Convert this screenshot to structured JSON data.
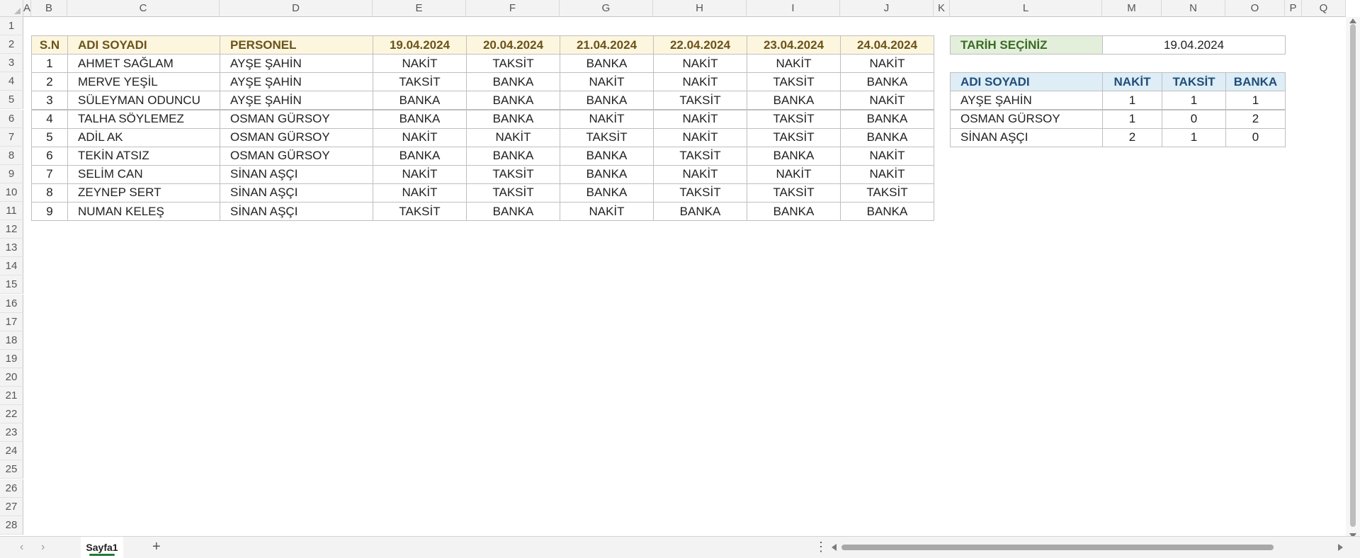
{
  "sheet": {
    "columns": [
      "A",
      "B",
      "C",
      "D",
      "E",
      "F",
      "G",
      "H",
      "I",
      "J",
      "K",
      "L",
      "M",
      "N",
      "O",
      "P",
      "Q"
    ],
    "rows": [
      "1",
      "2",
      "3",
      "4",
      "5",
      "6",
      "7",
      "8",
      "9",
      "10",
      "11",
      "12",
      "13",
      "14",
      "15",
      "16",
      "17",
      "18",
      "19",
      "20",
      "21",
      "22",
      "23",
      "24",
      "25",
      "26",
      "27",
      "28"
    ]
  },
  "main_table": {
    "headers": [
      "S.N",
      "ADI SOYADI",
      "PERSONEL",
      "19.04.2024",
      "20.04.2024",
      "21.04.2024",
      "22.04.2024",
      "23.04.2024",
      "24.04.2024"
    ],
    "rows": [
      [
        "1",
        "AHMET SAĞLAM",
        "AYŞE ŞAHİN",
        "NAKİT",
        "TAKSİT",
        "BANKA",
        "NAKİT",
        "NAKİT",
        "NAKİT"
      ],
      [
        "2",
        "MERVE YEŞİL",
        "AYŞE ŞAHİN",
        "TAKSİT",
        "BANKA",
        "NAKİT",
        "NAKİT",
        "TAKSİT",
        "BANKA"
      ],
      [
        "3",
        "SÜLEYMAN ODUNCU",
        "AYŞE ŞAHİN",
        "BANKA",
        "BANKA",
        "BANKA",
        "TAKSİT",
        "BANKA",
        "NAKİT"
      ],
      [
        "4",
        "TALHA SÖYLEMEZ",
        "OSMAN GÜRSOY",
        "BANKA",
        "BANKA",
        "NAKİT",
        "NAKİT",
        "TAKSİT",
        "BANKA"
      ],
      [
        "5",
        "ADİL AK",
        "OSMAN GÜRSOY",
        "NAKİT",
        "NAKİT",
        "TAKSİT",
        "NAKİT",
        "TAKSİT",
        "BANKA"
      ],
      [
        "6",
        " TEKİN ATSIZ",
        "OSMAN GÜRSOY",
        "BANKA",
        "BANKA",
        "BANKA",
        "TAKSİT",
        "BANKA",
        "NAKİT"
      ],
      [
        "7",
        "SELİM CAN",
        "SİNAN AŞÇI",
        "NAKİT",
        "TAKSİT",
        "BANKA",
        "NAKİT",
        "NAKİT",
        "NAKİT"
      ],
      [
        "8",
        "ZEYNEP SERT",
        "SİNAN AŞÇI",
        "NAKİT",
        "TAKSİT",
        "BANKA",
        "TAKSİT",
        "TAKSİT",
        "TAKSİT"
      ],
      [
        "9",
        "NUMAN KELEŞ",
        "SİNAN AŞÇI",
        "TAKSİT",
        "BANKA",
        "NAKİT",
        "BANKA",
        "BANKA",
        "BANKA"
      ]
    ]
  },
  "date_selector": {
    "label": "TARİH SEÇİNİZ",
    "value": "19.04.2024"
  },
  "summary_table": {
    "headers": [
      "ADI SOYADI",
      "NAKİT",
      "TAKSİT",
      "BANKA"
    ],
    "rows": [
      [
        "AYŞE ŞAHİN",
        "1",
        "1",
        "1"
      ],
      [
        "OSMAN GÜRSOY",
        "1",
        "0",
        "2"
      ],
      [
        "SİNAN AŞÇI",
        "2",
        "1",
        "0"
      ]
    ]
  },
  "tabs": {
    "active": "Sayfa1",
    "add": "+"
  },
  "icons": {
    "prev": "chevron-left-icon",
    "next": "chevron-right-icon",
    "more": "more-dots-icon"
  },
  "colors": {
    "header_yellow": "#fdf6df",
    "header_green": "#e3efdb",
    "header_blue": "#deedf6",
    "tab_accent": "#1f7a3a"
  }
}
